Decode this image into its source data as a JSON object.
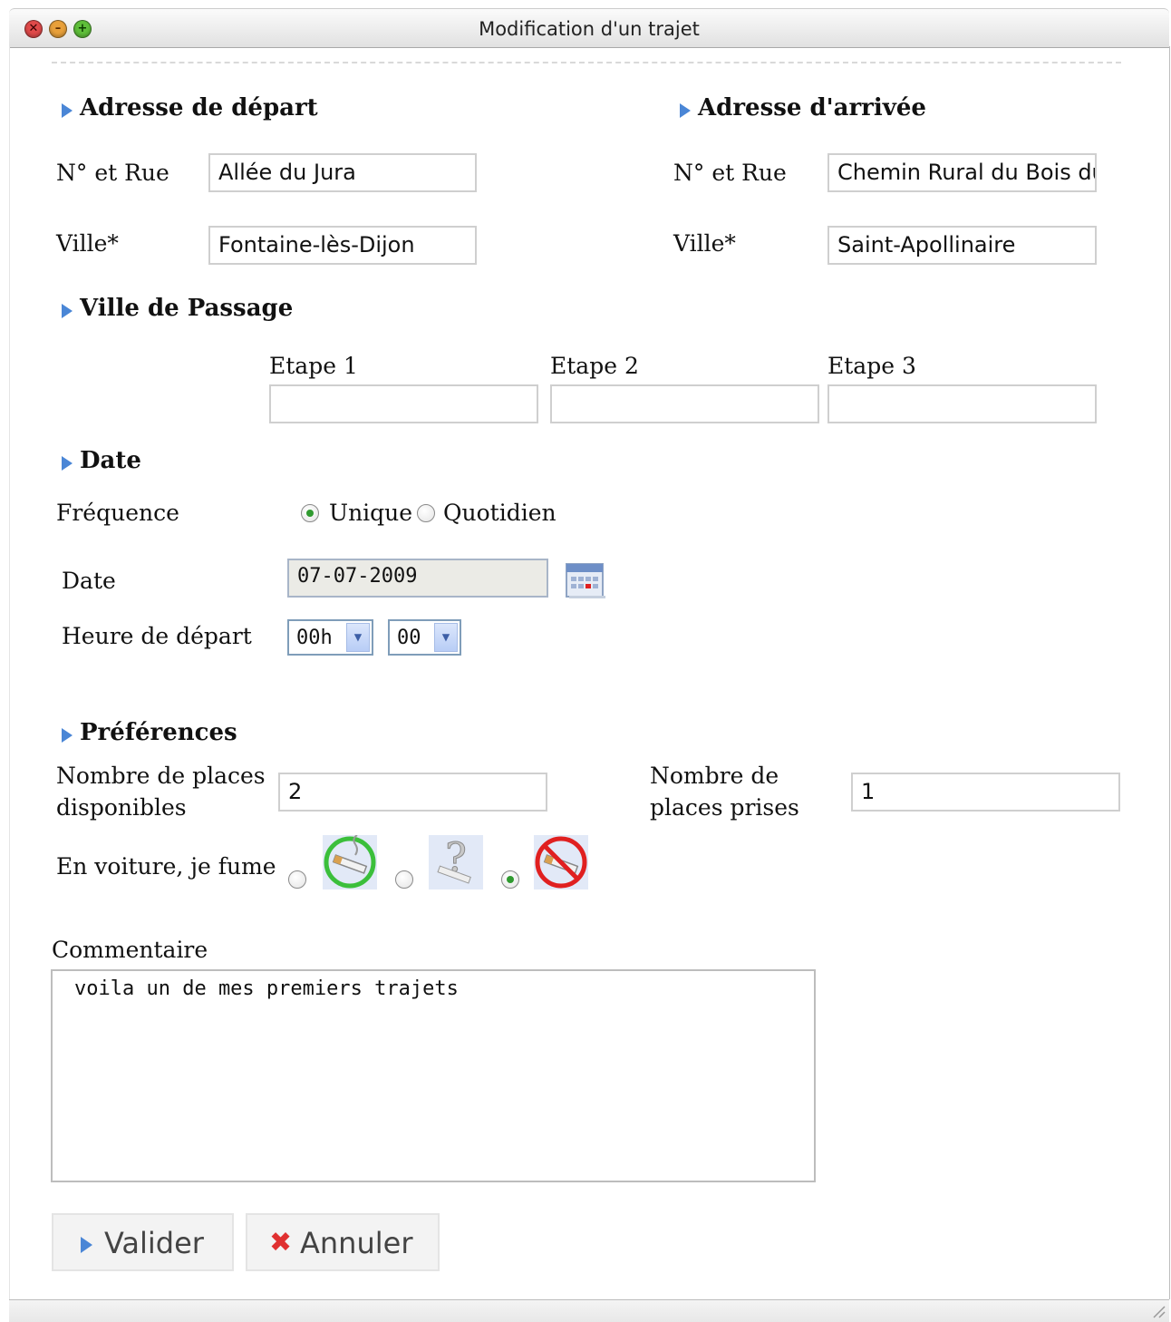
{
  "window": {
    "title": "Modification d'un trajet"
  },
  "depart": {
    "heading": "Adresse de départ",
    "street_label": "N° et Rue",
    "street_value": "Allée du Jura",
    "city_label": "Ville*",
    "city_value": "Fontaine-lès-Dijon"
  },
  "arrivee": {
    "heading": "Adresse d'arrivée",
    "street_label": "N° et Rue",
    "street_value": "Chemin Rural du Bois du",
    "city_label": "Ville*",
    "city_value": "Saint-Apollinaire"
  },
  "passage": {
    "heading": "Ville de Passage",
    "steps": [
      {
        "label": "Etape 1",
        "value": ""
      },
      {
        "label": "Etape 2",
        "value": ""
      },
      {
        "label": "Etape 3",
        "value": ""
      }
    ]
  },
  "date": {
    "heading": "Date",
    "frequency_label": "Fréquence",
    "frequency_options": [
      "Unique",
      "Quotidien"
    ],
    "frequency_selected": "Unique",
    "date_label": "Date",
    "date_value": "07-07-2009",
    "time_label": "Heure de départ",
    "hour_value": "00h",
    "minute_value": "00"
  },
  "preferences": {
    "heading": "Préférences",
    "seats_available_label_1": "Nombre de places",
    "seats_available_label_2": "disponibles",
    "seats_available_value": "2",
    "seats_taken_label_1": "Nombre de",
    "seats_taken_label_2": "places prises",
    "seats_taken_value": "1",
    "smoke_label": "En voiture, je fume",
    "smoke_options": [
      "smoking-icon",
      "question-icon",
      "no-smoking-icon"
    ],
    "smoke_selected": "no-smoking-icon"
  },
  "comment": {
    "label": "Commentaire",
    "value": "voila un de mes premiers trajets"
  },
  "actions": {
    "validate_label": "Valider",
    "cancel_label": "Annuler"
  },
  "colors": {
    "accent": "#4a86d6",
    "radio_dot": "#2f9a2f",
    "cancel": "#e03030"
  }
}
